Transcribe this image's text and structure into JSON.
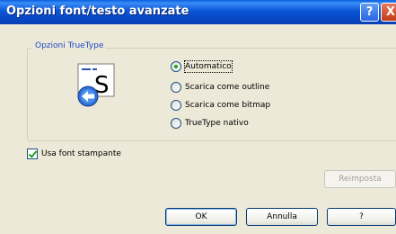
{
  "window": {
    "title": "Opzioni font/testo avanzate",
    "help_glyph": "?",
    "close_glyph": "X"
  },
  "group": {
    "label": "Opzioni TrueType",
    "icon": "truetype-download-icon"
  },
  "radios": [
    {
      "label": "Automatico",
      "selected": true
    },
    {
      "label": "Scarica come outline",
      "selected": false
    },
    {
      "label": "Scarica come bitmap",
      "selected": false
    },
    {
      "label": "TrueType nativo",
      "selected": false
    }
  ],
  "checkbox": {
    "label": "Usa font stampante",
    "checked": true
  },
  "buttons": {
    "reset": "Reimposta",
    "ok": "OK",
    "cancel": "Annulla",
    "help": "?"
  }
}
